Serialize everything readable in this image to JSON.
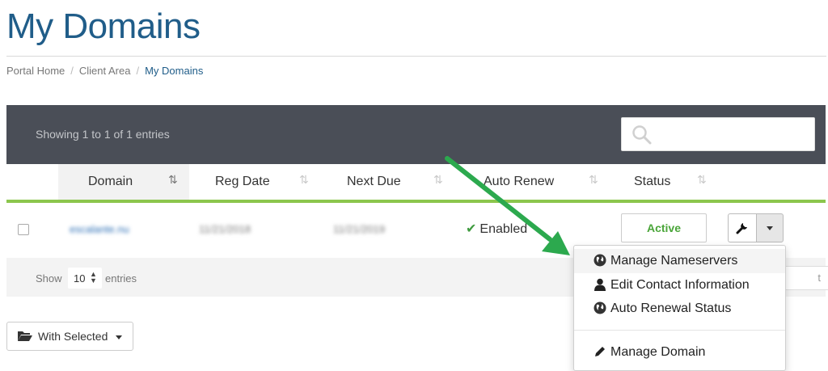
{
  "page": {
    "title": "My Domains"
  },
  "breadcrumb": {
    "items": [
      "Portal Home",
      "Client Area",
      "My Domains"
    ]
  },
  "table": {
    "info": "Showing 1 to 1 of 1 entries",
    "search": {
      "placeholder": "",
      "value": ""
    },
    "columns": [
      "Domain",
      "Reg Date",
      "Next Due",
      "Auto Renew",
      "Status"
    ],
    "sort_icon": "⇅",
    "rows": [
      {
        "domain": "escalante.nu",
        "reg_date": "11/21/2018",
        "next_due": "11/21/2019",
        "auto_renew": "Enabled",
        "status": "Active"
      }
    ],
    "footer": {
      "show_label": "Show",
      "page_length": "10",
      "entries_label": "entries",
      "pager_label": "t"
    }
  },
  "actions_menu": {
    "items": [
      {
        "label": "Manage Nameservers",
        "icon": "globe-icon"
      },
      {
        "label": "Edit Contact Information",
        "icon": "user-icon"
      },
      {
        "label": "Auto Renewal Status",
        "icon": "globe-icon"
      },
      {
        "label": "Manage Domain",
        "icon": "pencil-icon"
      }
    ]
  },
  "bulk": {
    "with_selected_label": "With Selected"
  },
  "colors": {
    "title_blue": "#205d89",
    "header_bar": "#4a4e57",
    "accent_green": "#8cc64d",
    "status_green": "#4aa539",
    "annotation_arrow": "#2ca94e"
  },
  "icons": [
    "search-icon",
    "sort-icon",
    "check-icon",
    "wrench-icon",
    "caret-down-icon",
    "folder-open-icon",
    "globe-icon",
    "user-icon",
    "pencil-icon",
    "arrow-icon"
  ]
}
